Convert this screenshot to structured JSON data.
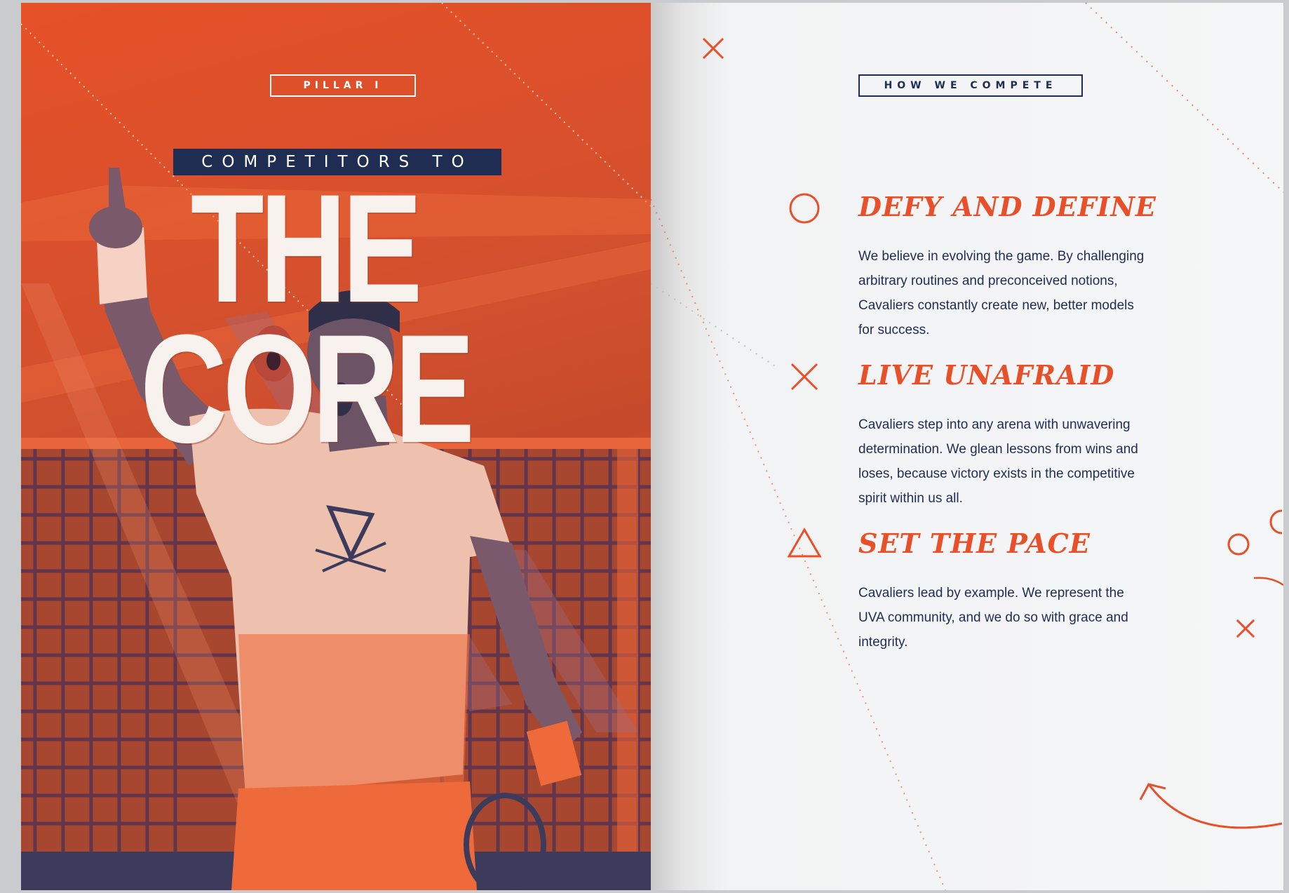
{
  "left_page": {
    "pillar_tag": "PILLAR I",
    "subtitle": "COMPETITORS TO",
    "title": "THE CORE",
    "colors": {
      "accent": "#e8502a",
      "navy": "#1f2d52"
    }
  },
  "right_page": {
    "tag": "HOW WE COMPETE",
    "pillars": [
      {
        "icon": "circle-icon",
        "heading": "DEFY AND DEFINE",
        "body": "We believe in evolving the game. By challenging arbitrary routines and preconceived notions, Cavaliers constantly create new, better models for success."
      },
      {
        "icon": "x-icon",
        "heading": "LIVE UNAFRAID",
        "body": "Cavaliers step into any arena with unwavering determination. We glean lessons from wins and loses, because victory exists in the competitive spirit within us all."
      },
      {
        "icon": "triangle-icon",
        "heading": "SET THE PACE",
        "body": "Cavaliers lead by example. We represent the UVA community, and we do so with grace and integrity."
      }
    ]
  }
}
